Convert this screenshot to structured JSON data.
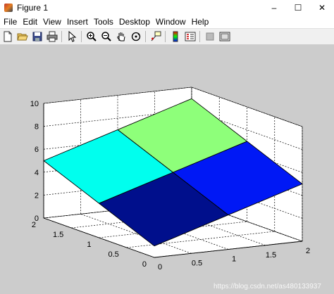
{
  "window": {
    "title": "Figure 1",
    "controls": {
      "minimize": "–",
      "maximize": "☐",
      "close": "✕"
    }
  },
  "menu": [
    "File",
    "Edit",
    "View",
    "Insert",
    "Tools",
    "Desktop",
    "Window",
    "Help"
  ],
  "toolbar": {
    "icons": [
      "new-figure-icon",
      "open-file-icon",
      "save-icon",
      "print-icon",
      "arrow-pointer-icon",
      "zoom-in-icon",
      "zoom-out-icon",
      "pan-hand-icon",
      "rotate-3d-icon",
      "data-cursor-icon",
      "colorbar-icon",
      "legend-icon",
      "hide-plot-tools-icon",
      "show-plot-tools-icon"
    ]
  },
  "chart_data": {
    "type": "surface",
    "x": [
      0,
      1,
      2
    ],
    "y": [
      0,
      1,
      2
    ],
    "z": [
      [
        1,
        3,
        5
      ],
      [
        3,
        5,
        7
      ],
      [
        5,
        7,
        9
      ]
    ],
    "faces": [
      {
        "x": [
          0,
          1
        ],
        "y": [
          0,
          1
        ],
        "color": "#000f8c"
      },
      {
        "x": [
          1,
          2
        ],
        "y": [
          0,
          1
        ],
        "color": "#0018f5"
      },
      {
        "x": [
          0,
          1
        ],
        "y": [
          1,
          2
        ],
        "color": "#00ffee"
      },
      {
        "x": [
          1,
          2
        ],
        "y": [
          1,
          2
        ],
        "color": "#8eff7a"
      }
    ],
    "xlim": [
      0,
      2
    ],
    "ylim": [
      0,
      2
    ],
    "zlim": [
      0,
      10
    ],
    "x_ticks": [
      "0",
      "0.5",
      "1",
      "1.5",
      "2"
    ],
    "y_ticks": [
      "0",
      "0.5",
      "1",
      "1.5",
      "2"
    ],
    "z_ticks": [
      "0",
      "2",
      "4",
      "6",
      "8",
      "10"
    ],
    "grid": true,
    "background": "#cccccc",
    "axes_color": "#ffffff"
  },
  "watermark": "https://blog.csdn.net/as480133937"
}
